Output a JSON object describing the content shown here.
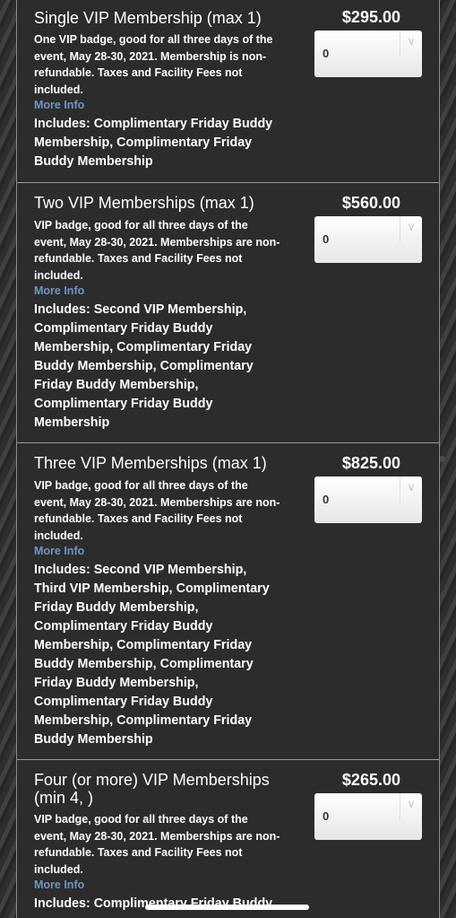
{
  "tickets": [
    {
      "name": "Single VIP Membership (max 1)",
      "price": "$295.00",
      "description": "One VIP badge, good for all three days of the event, May 28-30, 2021. Membership is non-refundable. Taxes and Facility Fees not included.",
      "more_info": "More Info",
      "includes": "Includes: Complimentary Friday Buddy Membership, Complimentary Friday Buddy Membership",
      "quantity": "0",
      "arrow": "∨"
    },
    {
      "name": "Two VIP Memberships (max 1)",
      "price": "$560.00",
      "description": "VIP badge, good for all three days of the event, May 28-30, 2021. Memberships are non-refundable. Taxes and Facility Fees not included.",
      "more_info": "More Info",
      "includes": "Includes: Second VIP Membership, Complimentary Friday Buddy Membership, Complimentary Friday Buddy Membership, Complimentary Friday Buddy Membership, Complimentary Friday Buddy Membership",
      "quantity": "0",
      "arrow": "∨"
    },
    {
      "name": "Three VIP Memberships (max 1)",
      "price": "$825.00",
      "description": "VIP badge, good for all three days of the event, May 28-30, 2021. Memberships are non-refundable. Taxes and Facility Fees not included.",
      "more_info": "More Info",
      "includes": "Includes: Second VIP Membership, Third VIP Membership, Complimentary Friday Buddy Membership, Complimentary Friday Buddy Membership, Complimentary Friday Buddy Membership, Complimentary Friday Buddy Membership, Complimentary Friday Buddy Membership, Complimentary Friday Buddy Membership",
      "quantity": "0",
      "arrow": "∨"
    },
    {
      "name": "Four (or more) VIP Memberships (min 4, )",
      "price": "$265.00",
      "description": "VIP badge, good for all three days of the event, May 28-30, 2021. Memberships are non-refundable. Taxes and Facility Fees not included.",
      "more_info": "More Info",
      "includes": "Includes: Complimentary Friday Buddy",
      "quantity": "0",
      "arrow": "∨"
    }
  ]
}
